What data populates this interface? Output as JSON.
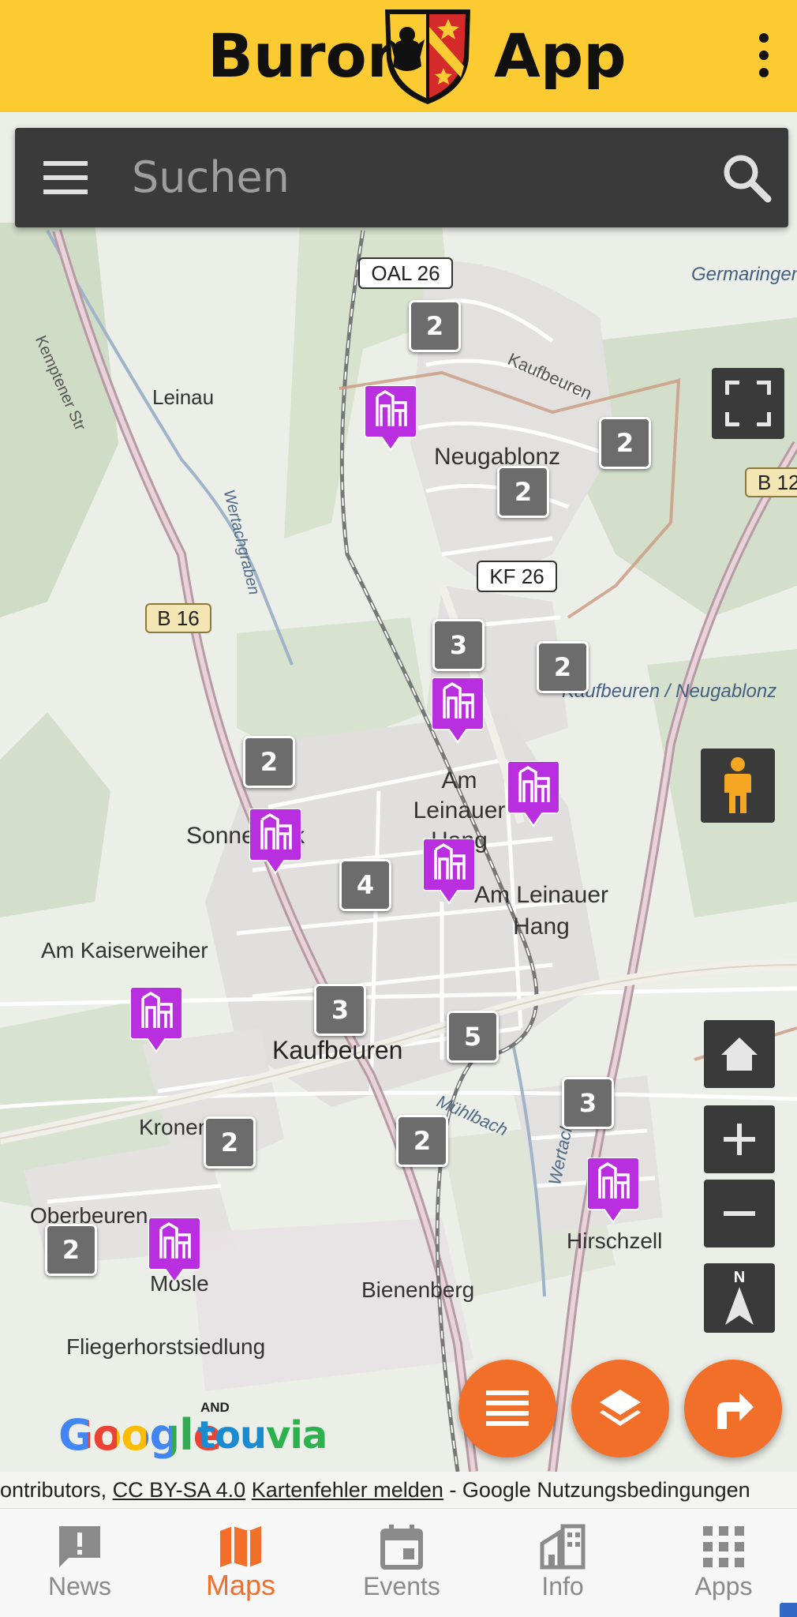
{
  "app_bar": {
    "title_left": "Buron",
    "title_right": "App",
    "crest_icon": "coat-of-arms-icon",
    "overflow_icon": "more-vert-icon"
  },
  "search": {
    "placeholder": "Suchen",
    "menu_icon": "hamburger-icon",
    "search_icon": "search-icon"
  },
  "map": {
    "places": [
      "Leinau",
      "Neugablonz",
      "Sonneneck",
      "Am Leinauer Hang",
      "Am Kaiserweiher",
      "Kaufbeuren",
      "Kronenberg",
      "Oberbeuren",
      "Mösle",
      "Fliegerhorstsiedlung",
      "Bienenberg",
      "Hirschzell",
      "Germaringen",
      "Kaufbeuren / Neugablonz"
    ],
    "road_labels": [
      "OAL 26",
      "KF 26",
      "B 16",
      "B 12"
    ],
    "street_labels": [
      "Kemptener Str",
      "Wertachgraben",
      "Kaufbeuren",
      "Mühlbach",
      "Wertach"
    ],
    "clusters": [
      {
        "count": "2"
      },
      {
        "count": "2"
      },
      {
        "count": "2"
      },
      {
        "count": "3"
      },
      {
        "count": "2"
      },
      {
        "count": "2"
      },
      {
        "count": "4"
      },
      {
        "count": "3"
      },
      {
        "count": "5"
      },
      {
        "count": "3"
      },
      {
        "count": "2"
      },
      {
        "count": "2"
      },
      {
        "count": "2"
      }
    ],
    "poi_icon": "playground-icon",
    "poi_color": "#b92fe0",
    "cluster_color": "#6c6c6c"
  },
  "controls": {
    "fullscreen_icon": "fullscreen-icon",
    "streetview_icon": "pegman-icon",
    "home_icon": "home-icon",
    "zoom_in_icon": "plus-icon",
    "zoom_out_icon": "minus-icon",
    "compass_icon": "compass-north-icon",
    "compass_label": "N"
  },
  "fabs": [
    {
      "icon": "list-icon"
    },
    {
      "icon": "layers-icon"
    },
    {
      "icon": "directions-icon"
    }
  ],
  "logos": {
    "and": "AND",
    "google": "Google",
    "touvia": "touvia"
  },
  "attribution": {
    "prefix": "ontributors, ",
    "license": "CC BY-SA 4.0",
    "report": "Kartenfehler melden",
    "separator": " - ",
    "google_terms": "Google Nutzungsbedingungen"
  },
  "bottom_nav": [
    {
      "label": "News",
      "icon": "announcement-icon",
      "active": false
    },
    {
      "label": "Maps",
      "icon": "map-icon",
      "active": true
    },
    {
      "label": "Events",
      "icon": "calendar-icon",
      "active": false
    },
    {
      "label": "Info",
      "icon": "info-building-icon",
      "active": false
    },
    {
      "label": "Apps",
      "icon": "apps-grid-icon",
      "active": false
    }
  ],
  "colors": {
    "app_bar": "#fccb32",
    "accent": "#f26f2a",
    "control_bg": "#3a3a3a",
    "pegman": "#f5a623"
  }
}
